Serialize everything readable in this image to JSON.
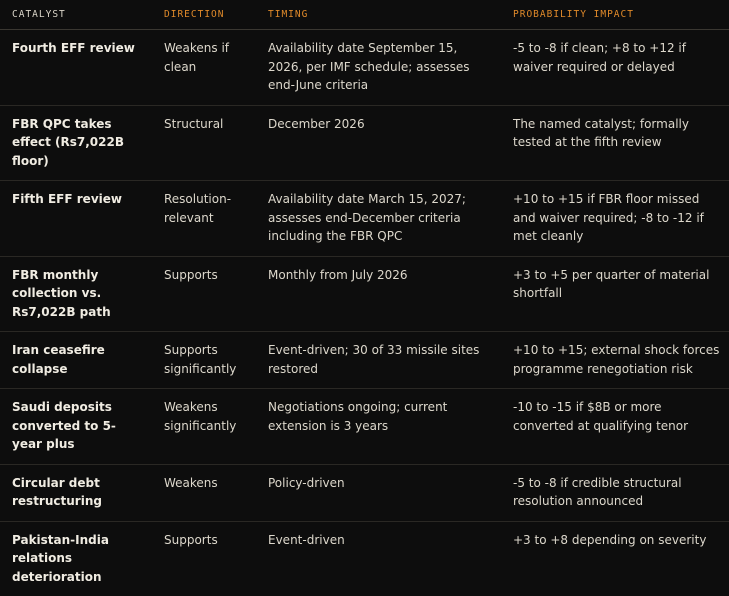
{
  "headers": {
    "catalyst": "CATALYST",
    "direction": "DIRECTION",
    "timing": "TIMING",
    "impact": "PROBABILITY IMPACT"
  },
  "accent_color": "#e08a2a",
  "rows": [
    {
      "catalyst": "Fourth EFF review",
      "direction": "Weakens if clean",
      "timing": "Availability date September 15, 2026, per IMF schedule; assesses end-June criteria",
      "impact": "-5 to -8 if clean; +8 to +12 if waiver required or delayed"
    },
    {
      "catalyst": "FBR QPC takes effect (Rs7,022B floor)",
      "direction": "Structural",
      "timing": "December 2026",
      "impact": "The named catalyst; formally tested at the fifth review"
    },
    {
      "catalyst": "Fifth EFF review",
      "direction": "Resolution-relevant",
      "timing": "Availability date March 15, 2027; assesses end-December criteria including the FBR QPC",
      "impact": "+10 to +15 if FBR floor missed and waiver required; -8 to -12 if met cleanly"
    },
    {
      "catalyst": "FBR monthly collection vs. Rs7,022B path",
      "direction": "Supports",
      "timing": "Monthly from July 2026",
      "impact": "+3 to +5 per quarter of material shortfall"
    },
    {
      "catalyst": "Iran ceasefire collapse",
      "direction": "Supports significantly",
      "timing": "Event-driven; 30 of 33 missile sites restored",
      "impact": "+10 to +15; external shock forces programme renegotiation risk"
    },
    {
      "catalyst": "Saudi deposits converted to 5-year plus",
      "direction": "Weakens significantly",
      "timing": "Negotiations ongoing; current extension is 3 years",
      "impact": "-10 to -15 if $8B or more converted at qualifying tenor"
    },
    {
      "catalyst": "Circular debt restructuring",
      "direction": "Weakens",
      "timing": "Policy-driven",
      "impact": "-5 to -8 if credible structural resolution announced"
    },
    {
      "catalyst": "Pakistan-India relations deterioration",
      "direction": "Supports",
      "timing": "Event-driven",
      "impact": "+3 to +8 depending on severity"
    }
  ]
}
